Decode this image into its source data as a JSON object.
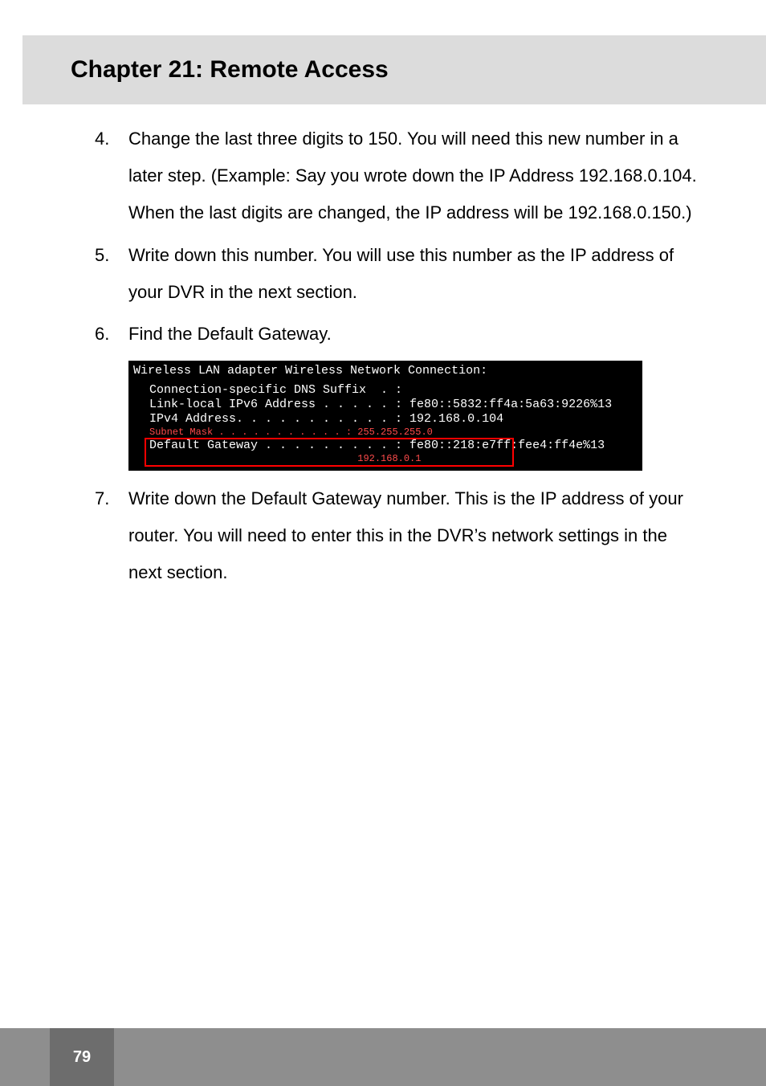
{
  "chapter_title": "Chapter 21: Remote Access",
  "items": {
    "4": {
      "num": "4.",
      "text": "Change the last three digits to 150. You will need this new number in a later step. (Example: Say you wrote down the IP Address 192.168.0.104. When the last digits are changed, the IP address will be 192.168.0.150.)"
    },
    "5": {
      "num": "5.",
      "text": "Write down this number. You will use this number as the IP address of your DVR in the next section."
    },
    "6": {
      "num": "6.",
      "text": "Find the Default Gateway."
    },
    "7": {
      "num": "7.",
      "text": "Write down the Default Gateway number. This is the IP address of your router. You will need to enter this in the DVR’s network settings in the next section."
    }
  },
  "terminal": {
    "header": "Wireless LAN adapter Wireless Network Connection:",
    "line1": "Connection-specific DNS Suffix  . :",
    "line2": "Link-local IPv6 Address . . . . . : fe80::5832:ff4a:5a63:9226%13",
    "line3": "IPv4 Address. . . . . . . . . . . : 192.168.0.104",
    "subnet": "Subnet Mask . . . . . . . . . . . : 255.255.255.0",
    "gateway1": "Default Gateway . . . . . . . . . : fe80::218:e7ff:fee4:ff4e%13",
    "gateway2": "                                    192.168.0.1"
  },
  "page_number": "79"
}
